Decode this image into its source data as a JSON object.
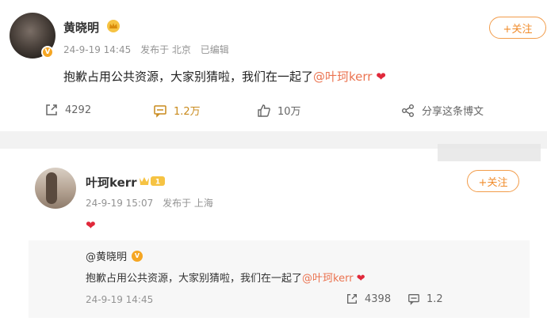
{
  "post1": {
    "author": "黄晓明",
    "date": "24-9-19 14:45",
    "source": "发布于 北京",
    "edited": "已编辑",
    "follow_label": "+关注",
    "content_text": "抱歉占用公共资源，大家别猜啦，我们在一起了",
    "mention": "@叶珂kerr",
    "actions": {
      "repost": "4292",
      "comment": "1.2万",
      "like": "10万",
      "share": "分享这条博文"
    }
  },
  "post2": {
    "author": "叶珂kerr",
    "date": "24-9-19 15:07",
    "source": "发布于 上海",
    "follow_label": "+关注",
    "quote": {
      "author": "@黄晓明",
      "content_text": "抱歉占用公共资源，大家别猜啦，我们在一起了",
      "mention": "@叶珂kerr",
      "date": "24-9-19 14:45",
      "repost": "4398",
      "comment": "1.2"
    }
  },
  "colors": {
    "accent": "#f08b2a",
    "mention": "#eb7350",
    "heart": "#e0283a",
    "verified": "#f5a623"
  }
}
